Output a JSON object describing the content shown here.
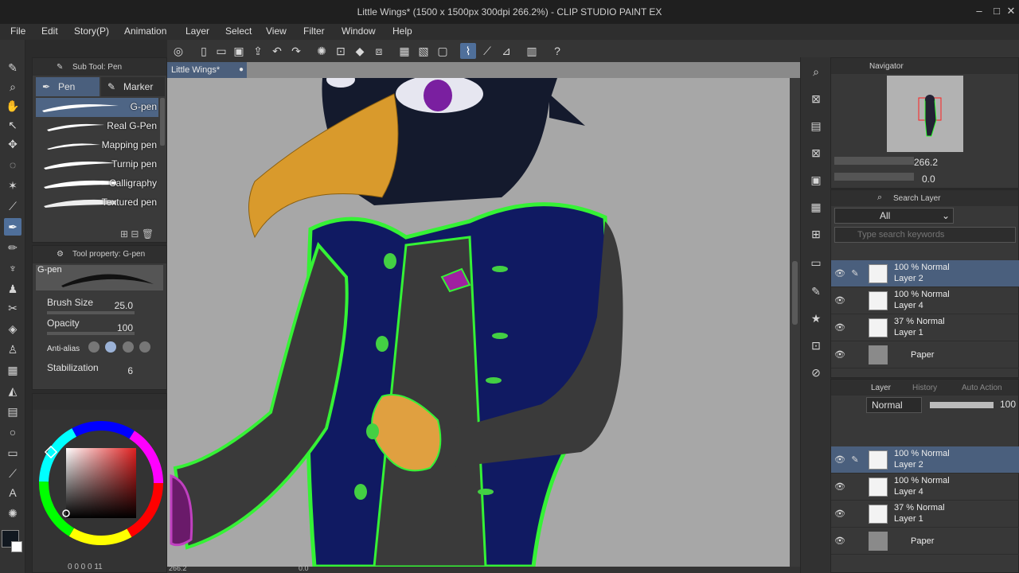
{
  "window": {
    "title": "Little Wings* (1500 x 1500px 300dpi 266.2%) - CLIP STUDIO PAINT EX"
  },
  "menu": [
    "File",
    "Edit",
    "Story(P)",
    "Animation",
    "Layer",
    "Select",
    "View",
    "Filter",
    "Window",
    "Help"
  ],
  "subtool": {
    "panel_title": "Sub Tool: Pen",
    "tabs": [
      "Pen",
      "Marker"
    ],
    "brushes": [
      "G-pen",
      "Real G-Pen",
      "Mapping pen",
      "Turnip pen",
      "Calligraphy",
      "Textured pen"
    ],
    "active_brush": "G-pen"
  },
  "tool_property": {
    "panel_title": "Tool property: G-pen",
    "preview_label": "G-pen",
    "brush_size_label": "Brush Size",
    "brush_size": "25.0",
    "opacity_label": "Opacity",
    "opacity": "100",
    "antialias_label": "Anti-alias",
    "stabilization_label": "Stabilization",
    "stabilization": "6"
  },
  "color": {
    "main": "#111820",
    "picked": "#1a1a1a",
    "hue": "#e02020"
  },
  "canvas": {
    "doc_tab": "Little Wings*",
    "zoom_status": "266.2",
    "rotation_status": "0.0"
  },
  "navigator": {
    "title": "Navigator",
    "zoom": "266.2",
    "rotation": "0.0"
  },
  "search_layer": {
    "title": "Search Layer",
    "filter": "All",
    "placeholder": "Type search keywords"
  },
  "layer_panel": {
    "tabs": [
      "Layer",
      "History",
      "Auto Action"
    ],
    "blend_mode": "Normal",
    "opacity": "100"
  },
  "layers": [
    {
      "line1": "100 % Normal",
      "line2": "Layer 2",
      "active": true
    },
    {
      "line1": "100 % Normal",
      "line2": "Layer 4",
      "active": false
    },
    {
      "line1": "37 % Normal",
      "line2": "Layer 1",
      "active": false
    },
    {
      "line1": "",
      "line2": "Paper",
      "active": false
    }
  ]
}
